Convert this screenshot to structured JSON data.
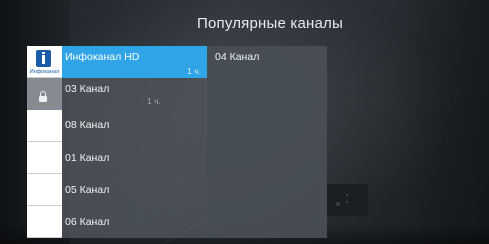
{
  "header": {
    "title": "Популярные каналы"
  },
  "channels": [
    {
      "name": "Инфоканал HD",
      "duration": "1 ч.",
      "logo_text": "Инфоканал",
      "selected": true,
      "locked": false
    },
    {
      "name": "03 Канал",
      "duration": "1 ч.",
      "selected": false,
      "locked": true
    },
    {
      "name": "08 Канал",
      "selected": false,
      "locked": false
    },
    {
      "name": "01 Канал",
      "selected": false,
      "locked": false
    },
    {
      "name": "05 Канал",
      "selected": false,
      "locked": false
    },
    {
      "name": "06 Канал",
      "selected": false,
      "locked": false
    }
  ],
  "second_column": {
    "name": "04 Канал"
  },
  "colors": {
    "accent": "#2fa4e6",
    "logo_blue": "#1b5ca8",
    "panel": "#4e545a"
  },
  "icons": {
    "lock": "lock-icon",
    "logo": "infokanal-logo-icon"
  }
}
